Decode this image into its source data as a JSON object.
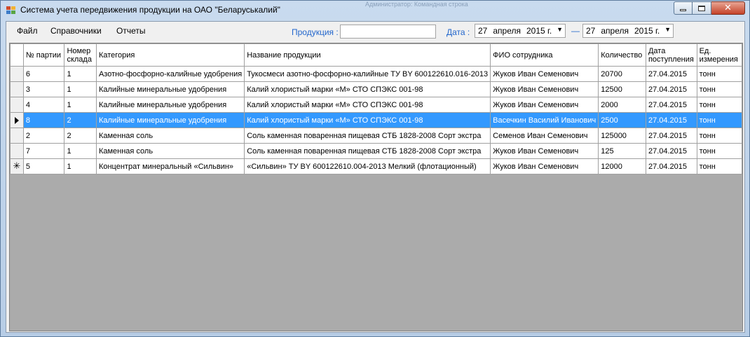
{
  "window": {
    "title": "Система учета передвижения продукции на ОАО \"Беларуськалий\"",
    "ghost_title": "Администратор: Командная строка",
    "close_glyph": "✕"
  },
  "menu": [
    "Файл",
    "Справочники",
    "Отчеты"
  ],
  "filters": {
    "product_label": "Продукция :",
    "product_value": "",
    "date_label": "Дата :",
    "date_from": {
      "day": "27",
      "month": "апреля",
      "year": "2015 г."
    },
    "dash": "—",
    "date_to": {
      "day": "27",
      "month": "апреля",
      "year": "2015 г."
    },
    "dropdown_glyph": "▼"
  },
  "grid": {
    "columns": [
      "№ партии",
      "Номер склада",
      "Категория",
      "Название продукции",
      "ФИО сотрудника",
      "Количество",
      "Дата поступления",
      "Ед. измерения"
    ],
    "rows": [
      [
        "6",
        "1",
        "Азотно-фосфорно-калийные удобрения",
        "Тукосмеси азотно-фосфорно-калийные  ТУ BY 600122610.016-2013",
        "Жуков Иван Семенович",
        "20700",
        "27.04.2015",
        "тонн"
      ],
      [
        "3",
        "1",
        "Калийные минеральные удобрения",
        "Калий хлористый марки «М» СТО СПЭКС 001-98",
        "Жуков Иван Семенович",
        "12500",
        "27.04.2015",
        "тонн"
      ],
      [
        "4",
        "1",
        "Калийные минеральные удобрения",
        "Калий хлористый марки «М» СТО СПЭКС 001-98",
        "Жуков Иван Семенович",
        "2000",
        "27.04.2015",
        "тонн"
      ],
      [
        "8",
        "2",
        "Калийные минеральные удобрения",
        "Калий хлористый марки «М» СТО СПЭКС 001-98",
        "Васечкин Василий Иванович",
        "2500",
        "27.04.2015",
        "тонн"
      ],
      [
        "2",
        "2",
        "Каменная соль",
        "Соль каменная поваренная пищевая СТБ  1828-2008 Сорт экстра",
        "Семенов Иван Семенович",
        "125000",
        "27.04.2015",
        "тонн"
      ],
      [
        "7",
        "1",
        "Каменная соль",
        "Соль каменная поваренная пищевая СТБ  1828-2008 Сорт экстра",
        "Жуков Иван Семенович",
        "125",
        "27.04.2015",
        "тонн"
      ],
      [
        "5",
        "1",
        "Концентрат минеральный «Сильвин»",
        "«Сильвин» ТУ BY 600122610.004-2013 Мелкий (флотационный)",
        "Жуков Иван Семенович",
        "12000",
        "27.04.2015",
        "тонн"
      ]
    ],
    "selected_row": 3,
    "new_row_marker": "✳"
  },
  "colors": {
    "selection": "#3399ff",
    "label_blue": "#2266cc",
    "grid_background": "#ababab"
  }
}
